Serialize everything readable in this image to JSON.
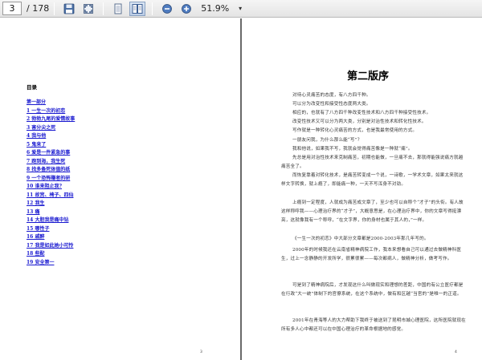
{
  "toolbar": {
    "current_page": "3",
    "total_pages": "/ 178",
    "zoom": "51.9%",
    "zoom_dropdown_icon": "▾",
    "buttons": [
      {
        "name": "save-icon"
      },
      {
        "name": "fullscreen-icon"
      },
      {
        "name": "single-page-icon"
      },
      {
        "name": "two-page-icon",
        "active": true
      },
      {
        "name": "zoom-out-icon"
      },
      {
        "name": "zoom-in-icon"
      }
    ]
  },
  "left_page": {
    "toc_title": "目录",
    "toc_items": [
      "第一部分",
      "1 一生一次的初恋",
      "2 勃勃九尾的爱情故事",
      "3 害分尖之死",
      "4 我与他",
      "5 鬼来了",
      "6 爱是一件紧急的事",
      "7 跑到海，我生死",
      "8 找多备死体值的纸",
      "9 一个恐怖赚者的研",
      "10 谁来阻止我?",
      "11 故宫、椅子、四仙",
      "12 我生",
      "13 痛",
      "14 大胆我是痛中钻",
      "15 哪性子",
      "16 戚醉",
      "17 我是如此她小可怜",
      "18 些配",
      "19 安全第一"
    ],
    "page_number": "3"
  },
  "right_page": {
    "chapter_title": "第二版序",
    "paragraphs": [
      "对待心灵痛苦的态度，有八方四千种。",
      "可以分为改变性和接受性态度两大类。",
      "相应的，也就有了八方四千种改变性技术和八方四千种接受性技术。",
      "改变性技术又可以分为两大类，分别是对治性技术和转化性技术。",
      "写作就是一种转化心灵痛苦的方式，也是我最常使用的方式。",
      "一朋友问我，为什么那么能“写”？",
      "我和他说，如果我不写，我就会觉得痛苦像是一种就“痛”。",
      "先总是用对治性技术来克制痛苦，初期也能做，一旦痛不去，那就得能强说痛方就越痛苦全了。",
      "而恢复靠着对转化技术，是痛苦转变成一个说，一诗歌，一学术文章，如果太来就这样文字转换，就上瘾了，即能痛一种，一天不写浑身不对劲。",
      "上瘾到一定程度，人就成为痛苦成文章了，至少也可以自称个“才子”的头衔。有人故这样称呼我——心理治疗界的“才子”，大概意思是，在心理治疗界中，你的文章写得挺漂亮，这就像我有一个称呼，“在文字界，你的身材也属于其人的，”一样。",
      "《一生一次的初恋》中大部分文章都是2000-2003年那几年写的。",
      "2000年的时候我还在云南省精神病院工作，我本来想看自己可以通过去做精神科医生，过上一念静静的开发所学，很累很累——每次都病人，做精神分析，做考写作。",
      "可是到了精神病院后，才发现这什么叫做现实和理想的差距，中国的有公立医疗都是在行政“大一统”体制下的官僚系统，在这个系统中，做有和区越“当官的”是唯一的正道。",
      "2001年在青海等人的大力帮助下我终于被送到了昆明市城心理医院，这所医院就现在所有多人心中都还可以在中国心理治疗的革命根据地的感觉。"
    ],
    "page_number": "4"
  }
}
